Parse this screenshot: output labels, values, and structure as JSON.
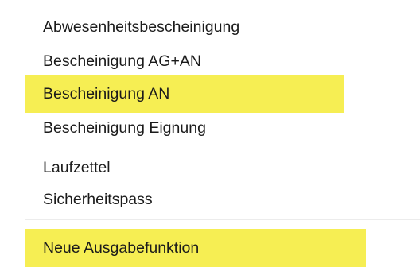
{
  "menu": {
    "items": [
      {
        "label": "Abwesenheitsbescheinigung",
        "highlighted": false
      },
      {
        "label": "Bescheinigung AG+AN",
        "highlighted": false
      },
      {
        "label": "Bescheinigung AN",
        "highlighted": true
      },
      {
        "label": "Bescheinigung Eignung",
        "highlighted": false
      },
      {
        "label": "Laufzettel",
        "highlighted": false
      },
      {
        "label": "Sicherheitspass",
        "highlighted": false
      }
    ],
    "after_separator": [
      {
        "label": "Neue Ausgabefunktion",
        "highlighted": true
      }
    ]
  },
  "colors": {
    "highlight": "#f6ee53",
    "text": "#1b1b1b",
    "background": "#ffffff",
    "separator": "#ececec"
  }
}
